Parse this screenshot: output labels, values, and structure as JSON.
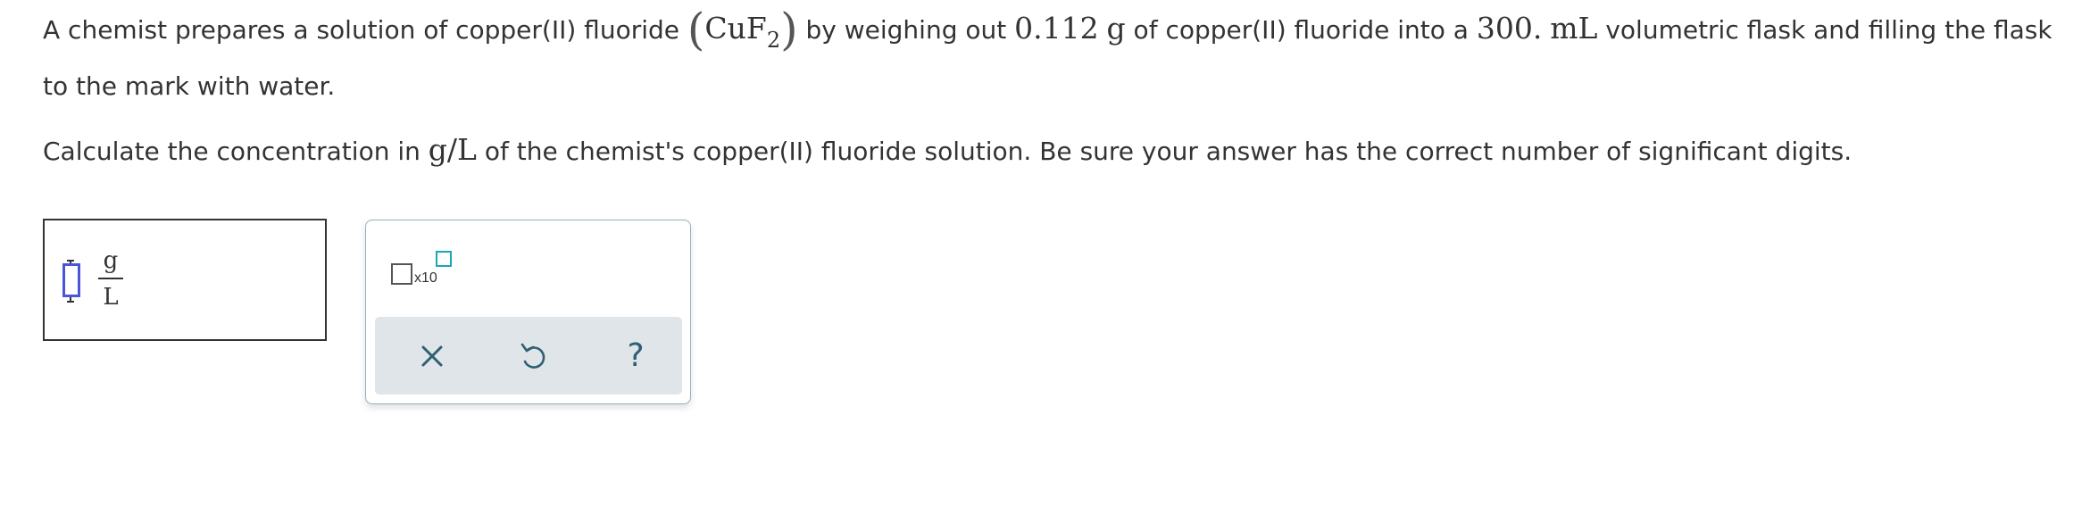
{
  "question": {
    "p1_a": "A chemist prepares a solution of copper(II) fluoride ",
    "p1_paren_open": "(",
    "p1_formula": "CuF",
    "p1_formula_sub": "2",
    "p1_paren_close": ")",
    "p1_b": " by weighing out ",
    "p1_mass": "0.112",
    "p1_mass_unit": "g",
    "p1_c": " of copper(II) fluoride into a ",
    "p1_volume": "300.",
    "p1_volume_unit": "mL",
    "p1_d": " volumetric flask and filling the flask to the mark with water.",
    "p2_a": "Calculate the concentration in ",
    "p2_unit": "g/L",
    "p2_b": " of the chemist's copper(II) fluoride solution. Be sure your answer has the correct number of significant digits."
  },
  "answer": {
    "value": "",
    "unit_numerator": "g",
    "unit_denominator": "L"
  },
  "toolbar": {
    "x10_label": "x10",
    "clear_icon": "close-icon",
    "undo_icon": "undo-icon",
    "help_icon": "help-icon",
    "help_glyph": "?"
  },
  "colors": {
    "text": "#333333",
    "accent_blue": "#4a56d8",
    "accent_teal": "#1aa7b8",
    "panel_border": "#9aaeb8",
    "action_bar": "#dfe5e8",
    "icon": "#2e5f74"
  }
}
